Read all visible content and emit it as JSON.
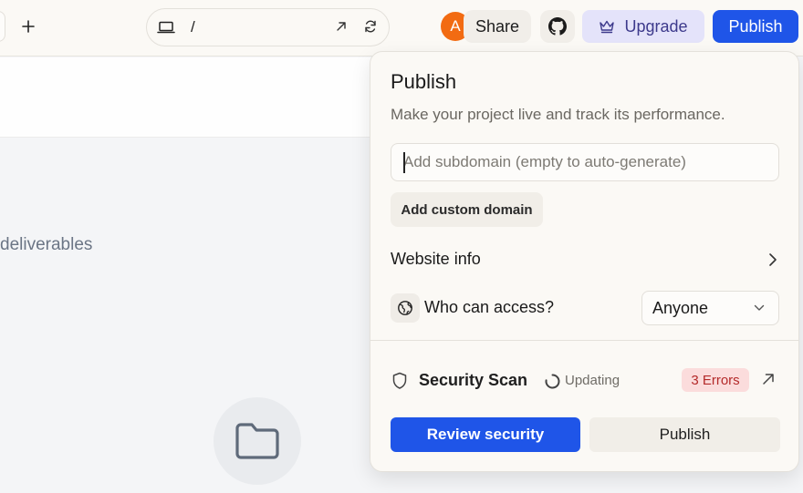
{
  "topbar": {
    "new_tab_icon": "plus-icon",
    "url": {
      "device_icon": "laptop-icon",
      "path": "/",
      "open_icon": "arrow-up-right-icon",
      "reload_icon": "refresh-icon"
    },
    "avatar_initial": "A",
    "share_label": "Share",
    "github_icon": "github-icon",
    "upgrade_label": "Upgrade",
    "upgrade_icon": "crown-icon",
    "publish_label": "Publish"
  },
  "background": {
    "deliverables_text": "deliverables",
    "folder_icon": "folder-icon"
  },
  "popover": {
    "title": "Publish",
    "subtitle": "Make your project live and track its performance.",
    "subdomain_placeholder": "Add subdomain (empty to auto-generate)",
    "subdomain_value": "",
    "custom_domain_label": "Add custom domain",
    "website_info_label": "Website info",
    "access_label": "Who can access?",
    "access_value": "Anyone",
    "security": {
      "label": "Security Scan",
      "status": "Updating",
      "errors": "3 Errors"
    },
    "review_label": "Review security",
    "publish_label": "Publish"
  },
  "colors": {
    "accent": "#1f55e8",
    "avatar": "#f26b12",
    "upgrade_bg": "#e4e3fa",
    "error_bg": "#fbdcdc",
    "error_text": "#b42a2a"
  }
}
